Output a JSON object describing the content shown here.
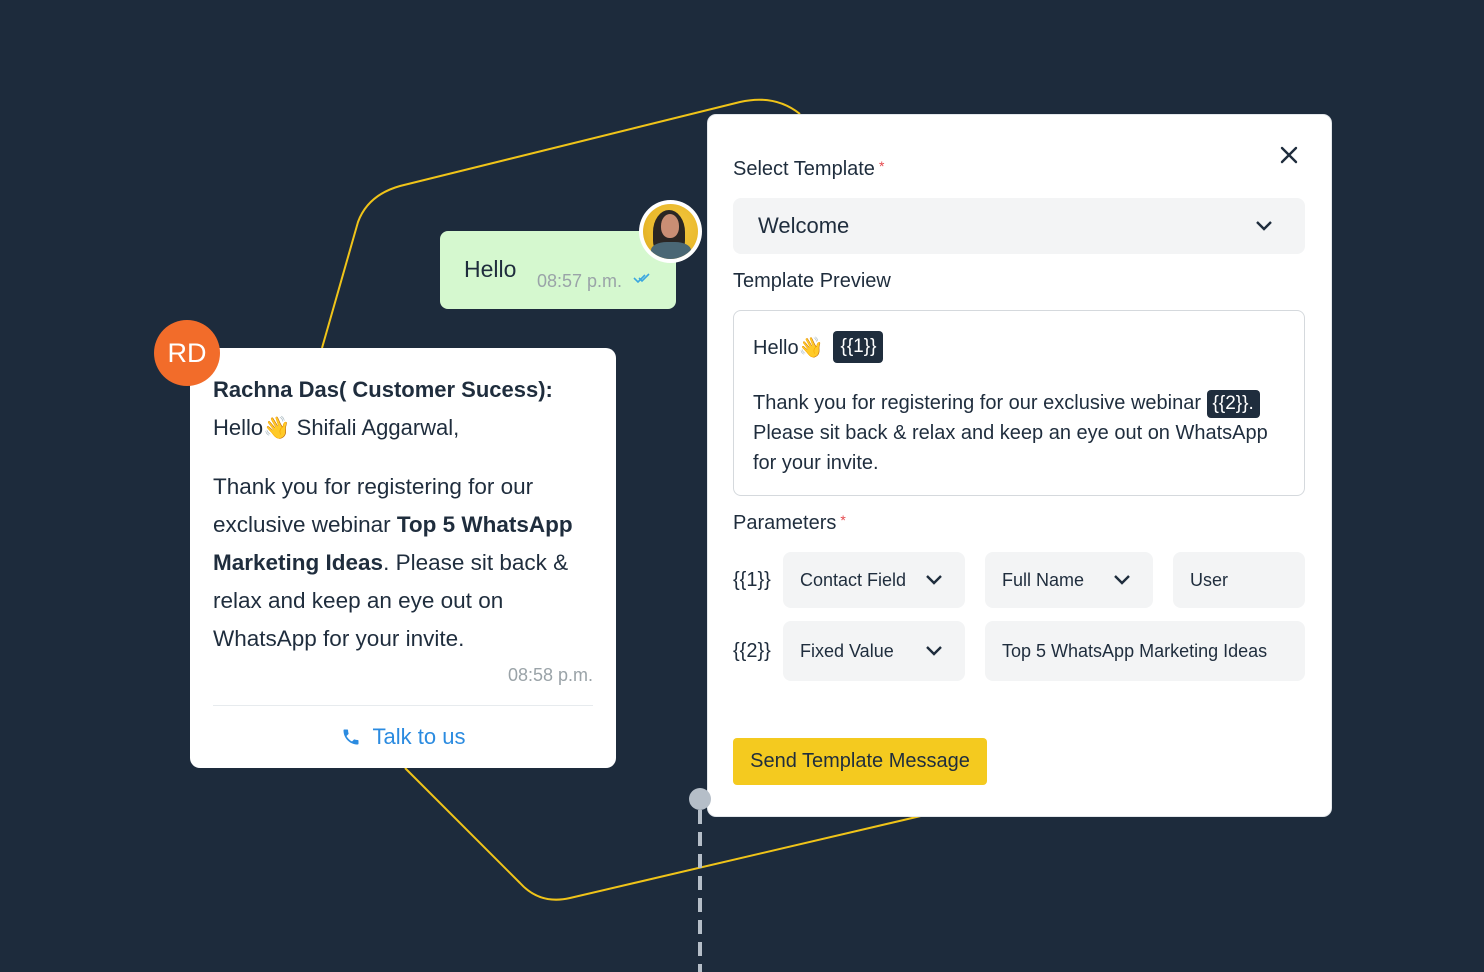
{
  "colors": {
    "background": "#1d2b3c",
    "connector": "#f0c419",
    "accent_yellow": "#f4ca1f",
    "avatar_orange": "#f26c2a",
    "sent_bubble": "#d5f8cf",
    "link_blue": "#2b8be0",
    "required_red": "#e5484d"
  },
  "sent_message": {
    "text": "Hello",
    "time": "08:57 p.m.",
    "status_icon": "double-check-icon"
  },
  "received_message": {
    "avatar_initials": "RD",
    "sender": "Rachna Das( Customer Sucess):",
    "greeting": "Hello👋  Shifali Aggarwal,",
    "body_part1": "Thank you for registering for our exclusive webinar ",
    "body_bold": "Top 5 WhatsApp Marketing Ideas",
    "body_part2": ". Please sit back & relax and keep an eye out on WhatsApp for your invite.",
    "time": "08:58 p.m.",
    "cta_label": "Talk to us",
    "cta_icon": "phone-icon"
  },
  "modal": {
    "select_template_label": "Select Template",
    "required_mark": "*",
    "selected_template": "Welcome",
    "template_preview_label": "Template Preview",
    "preview": {
      "greeting": "Hello👋",
      "var1": "{{1}}",
      "para_text": "Thank you for registering for our exclusive webinar ",
      "var2": "{{2}}.",
      "para_rest": "Please sit back & relax and keep an eye out on WhatsApp for your invite."
    },
    "parameters_label": "Parameters",
    "parameters": [
      {
        "key": "{{1}}",
        "type": "Contact Field",
        "field": "Full Name",
        "fallback": "User"
      },
      {
        "key": "{{2}}",
        "type": "Fixed Value",
        "value": "Top 5 WhatsApp Marketing Ideas"
      }
    ],
    "send_button": "Send Template Message",
    "close_icon": "close-icon"
  }
}
